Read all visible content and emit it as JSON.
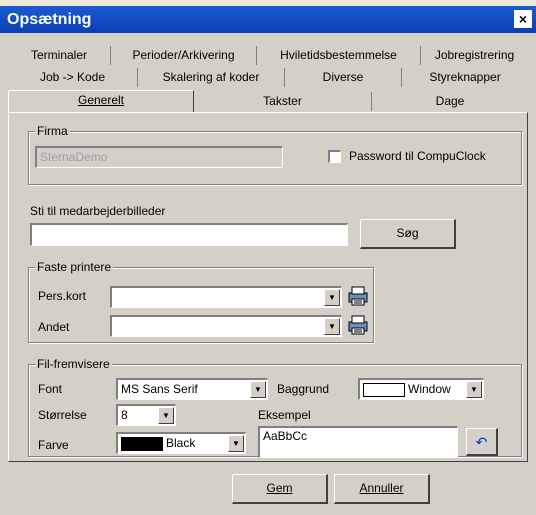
{
  "window": {
    "title": "Opsætning",
    "close_label": "×"
  },
  "tabs": {
    "row1": [
      {
        "label": "Terminaler"
      },
      {
        "label": "Perioder/Arkivering"
      },
      {
        "label": "Hviletidsbestemmelse"
      },
      {
        "label": "Jobregistrering"
      }
    ],
    "row2": [
      {
        "label": "Job -> Kode"
      },
      {
        "label": "Skalering af koder"
      },
      {
        "label": "Diverse"
      },
      {
        "label": "Styreknapper"
      }
    ],
    "row3": [
      {
        "label": "Generelt",
        "active": true
      },
      {
        "label": "Takster"
      },
      {
        "label": "Dage"
      }
    ]
  },
  "firma": {
    "legend": "Firma",
    "name_value": "SternaDemo",
    "password_label": "Password til CompuClock",
    "password_checked": false
  },
  "sti": {
    "label": "Sti til medarbejderbilleder",
    "value": "",
    "search_label": "Søg"
  },
  "printers": {
    "legend": "Faste printere",
    "pers_label": "Pers.kort",
    "pers_value": "",
    "andet_label": "Andet",
    "andet_value": ""
  },
  "viewers": {
    "legend": "Fil-fremvisere",
    "font_label": "Font",
    "font_value": "MS Sans Serif",
    "size_label": "Størrelse",
    "size_value": "8",
    "color_label": "Farve",
    "color_value": "Black",
    "color_swatch": "#000000",
    "bg_label": "Baggrund",
    "bg_value": "Window",
    "bg_swatch": "#ffffff",
    "example_label": "Eksempel",
    "example_text": "AaBbCc",
    "reset_icon": "undo-arrow-icon"
  },
  "footer": {
    "save_label": "Gem",
    "cancel_label": "Annuller"
  },
  "colors": {
    "title_bar": "#0b3fb5",
    "face": "#d4d0c8"
  }
}
